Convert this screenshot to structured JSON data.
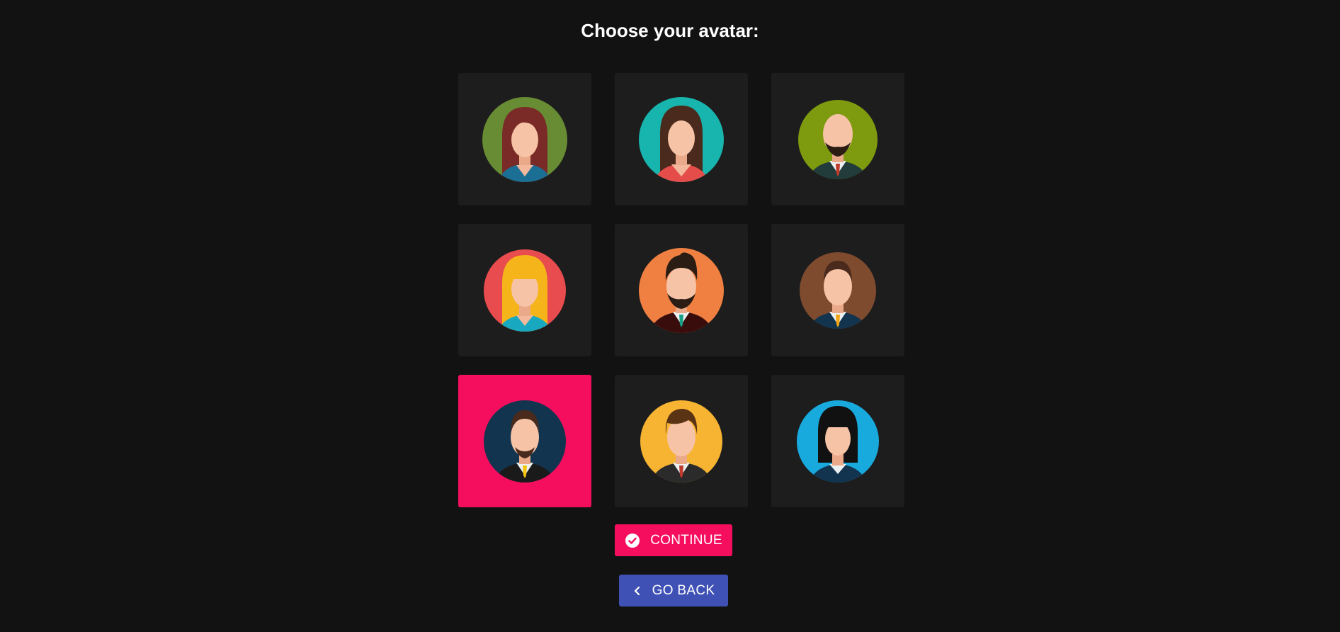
{
  "page": {
    "title": "Choose your avatar:"
  },
  "avatars": [
    {
      "id": "avatar-1",
      "bg": "#678c34",
      "selected": false
    },
    {
      "id": "avatar-2",
      "bg": "#17b5ad",
      "selected": false
    },
    {
      "id": "avatar-3",
      "bg": "#7e9a0f",
      "selected": false
    },
    {
      "id": "avatar-4",
      "bg": "#e84c4e",
      "selected": false
    },
    {
      "id": "avatar-5",
      "bg": "#ef8042",
      "selected": false
    },
    {
      "id": "avatar-6",
      "bg": "#7f4b2f",
      "selected": false
    },
    {
      "id": "avatar-7",
      "bg": "#12344f",
      "selected": true
    },
    {
      "id": "avatar-8",
      "bg": "#f6b432",
      "selected": false
    },
    {
      "id": "avatar-9",
      "bg": "#18a9dd",
      "selected": false
    }
  ],
  "actions": {
    "continue_label": "CONTINUE",
    "continue_icon": "check-circle-icon",
    "back_label": "GO BACK",
    "back_icon": "chevron-left-icon"
  },
  "colors": {
    "background": "#121212",
    "tile": "#1d1d1d",
    "accent": "#f50e5d",
    "secondary": "#3f51b5"
  }
}
